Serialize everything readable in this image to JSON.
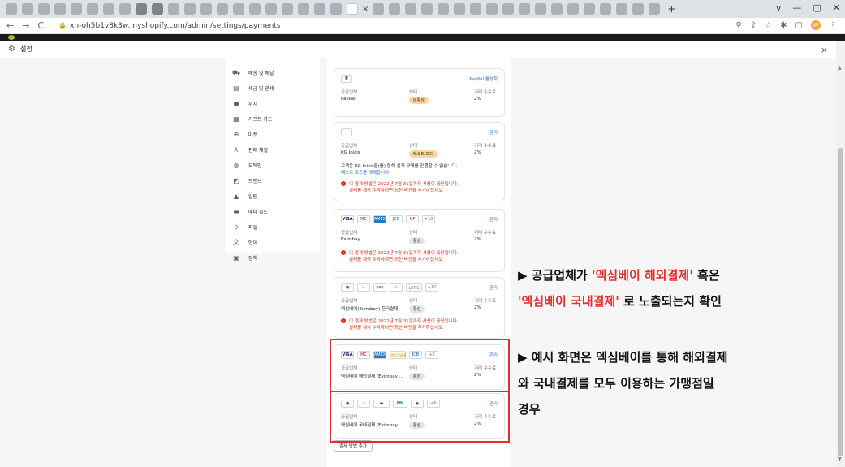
{
  "browser": {
    "url": "xn-oh5b1v8k3w.myshopify.com/admin/settings/payments",
    "new_tab": "+",
    "tab_close": "×",
    "window_controls": [
      "v",
      "—",
      "▢",
      "✕"
    ],
    "nav": [
      "←",
      "→",
      "C"
    ],
    "profile_initial": "W"
  },
  "settings_header": {
    "title": "설정",
    "close": "×"
  },
  "sidebar": {
    "items": [
      {
        "label": "배송 및 배달",
        "icon": "truck-icon"
      },
      {
        "label": "세금 및 관세",
        "icon": "tax-icon"
      },
      {
        "label": "위치",
        "icon": "location-pin-icon"
      },
      {
        "label": "기프트 카드",
        "icon": "gift-icon"
      },
      {
        "label": "마켓",
        "icon": "globe-icon"
      },
      {
        "label": "판매 채널",
        "icon": "sales-channel-icon"
      },
      {
        "label": "도메인",
        "icon": "domain-icon"
      },
      {
        "label": "브랜드",
        "icon": "brand-icon"
      },
      {
        "label": "알림",
        "icon": "bell-icon"
      },
      {
        "label": "메타 필드",
        "icon": "metafields-icon"
      },
      {
        "label": "파일",
        "icon": "paperclip-icon"
      },
      {
        "label": "언어",
        "icon": "language-icon"
      },
      {
        "label": "정책",
        "icon": "policy-icon"
      }
    ]
  },
  "cards": {
    "paypal": {
      "logo": "P",
      "action": "PayPal 활성화",
      "h_provider": "공급업체",
      "h_status": "상태",
      "h_fee": "거래 수수료",
      "provider": "PayPal",
      "status": "비활성",
      "fee": "2%"
    },
    "kg": {
      "logo": "—",
      "action": "관리",
      "h_provider": "공급업체",
      "h_status": "상태",
      "h_fee": "거래 수수료",
      "provider": "KG Inicis",
      "status": "테스트 모드",
      "fee": "2%",
      "note": "고객은 KG Inicis을(를) 통해 실제 구매를 진행할 수 없습니다.",
      "note_link": "테스트 모드를 해제합니다.",
      "warning_line1": "이 결제 방법은 2022년 7월 31일까지 사용이 중단됩니다.",
      "warning_line2": "결제를 계속 수락하려면 최신 버전을 추가하십시오."
    },
    "eximbay": {
      "logos": [
        "VISA",
        "MC",
        "AMEX",
        "JCB",
        "UP"
      ],
      "more": "+18",
      "action": "관리",
      "h_provider": "공급업체",
      "h_status": "상태",
      "h_fee": "거래 수수료",
      "provider": "Eximbay",
      "status": "활성",
      "fee": "2%",
      "warning_line1": "이 결제 방법은 2022년 7월 31일까지 사용이 중단됩니다.",
      "warning_line2": "결제를 계속 수락하려면 최신 버전을 추가하십시오."
    },
    "eximbay_kr": {
      "logos": [
        "●",
        "✓",
        "pay",
        "☀",
        "LOTTE"
      ],
      "more": "+10",
      "action": "관리",
      "h_provider": "공급업체",
      "h_status": "상태",
      "h_fee": "거래 수수료",
      "provider": "엑심베이(Eximbay) 한국결제",
      "status": "활성",
      "fee": "2%",
      "warning_line1": "이 결제 방법은 2022년 7월 31일까지 사용이 중단됩니다.",
      "warning_line2": "결제를 계속 수락하려면 최신 버전을 추가하십시오."
    },
    "eximbay_overseas": {
      "logos": [
        "VISA",
        "MC",
        "AMEX",
        "DISCOVER",
        "JCB"
      ],
      "more": "+6",
      "action": "관리",
      "h_provider": "공급업체",
      "h_status": "상태",
      "h_fee": "거래 수수료",
      "provider": "엑심베이 해외결제 (Eximbay ...",
      "status": "활성",
      "fee": "2%"
    },
    "eximbay_domestic": {
      "logos": [
        "●",
        "☀",
        "▬",
        "NH",
        "◉"
      ],
      "more": "+6",
      "action": "관리",
      "h_provider": "공급업체",
      "h_status": "상태",
      "h_fee": "거래 수수료",
      "provider": "엑심베이 국내결제 (Eximbay ...",
      "status": "활성",
      "fee": "2%"
    }
  },
  "add_payment_button": "결제 방법 추가",
  "annotations": {
    "line1_prefix": "▶ 공급업체가 ",
    "line1_red": "'엑심베이 해외결제'",
    "line1_suffix": " 혹은",
    "line2_red": "'엑심베이 국내결제'",
    "line2_suffix": " 로 노출되는지 확인",
    "line3": "▶ 예시 화면은 엑심베이를 통해 해외결제",
    "line4": "와 국내결제를 모두 이용하는 가맹점일",
    "line5": "경우"
  },
  "colors": {
    "accent_red": "#e03131",
    "link_blue": "#2c6ecb"
  }
}
